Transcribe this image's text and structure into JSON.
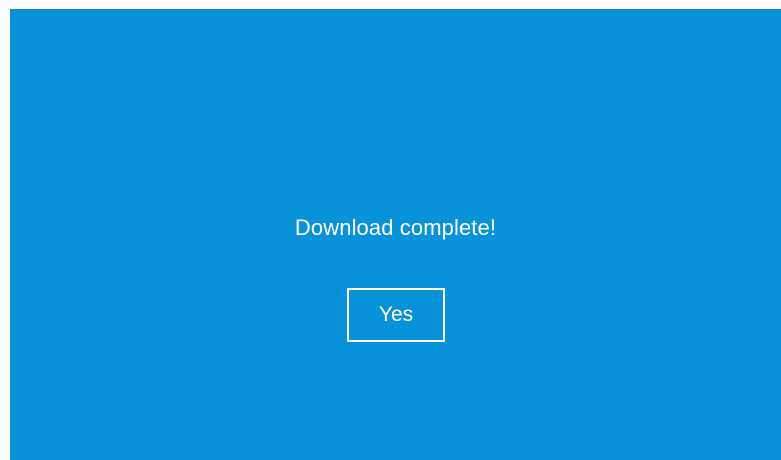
{
  "dialog": {
    "message": "Download complete!",
    "confirm_label": "Yes"
  },
  "colors": {
    "panel_background": "#0892d9",
    "text": "#ffffff",
    "frame_background": "#ffffff"
  }
}
